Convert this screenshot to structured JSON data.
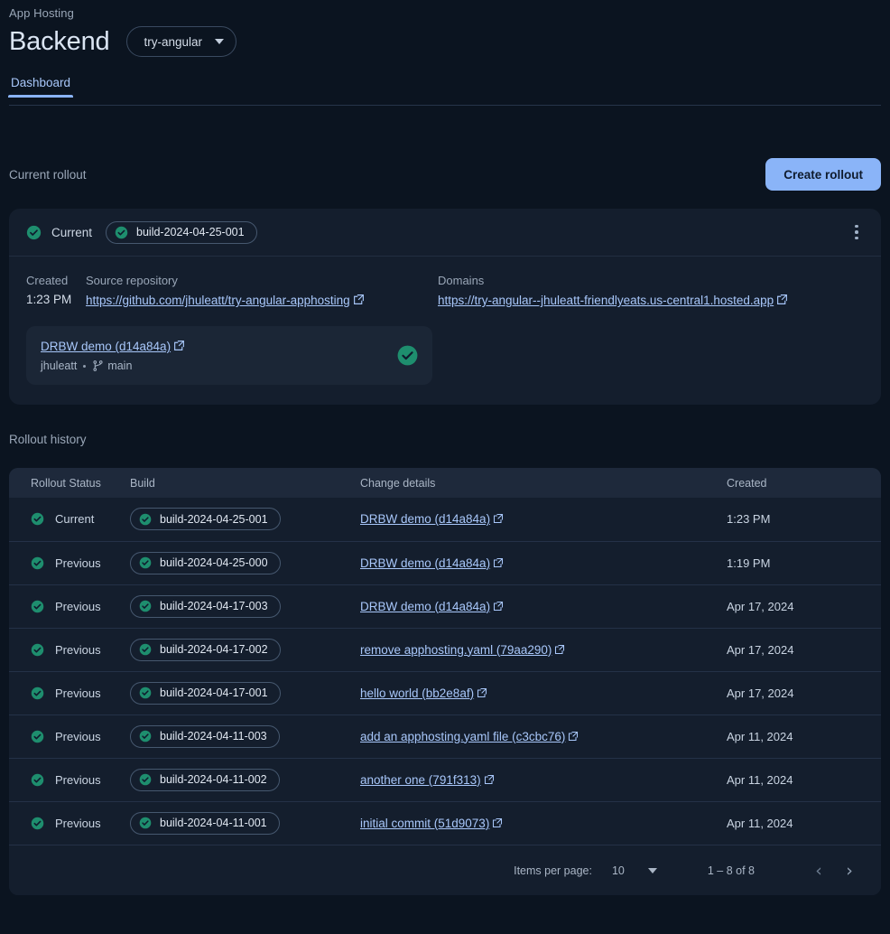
{
  "header": {
    "eyebrow": "App Hosting",
    "title": "Backend",
    "backend_chip": "try-angular",
    "chip_icon": "chevron-down-icon"
  },
  "tabs": [
    {
      "label": "Dashboard",
      "active": true
    }
  ],
  "current_rollout": {
    "section_title": "Current rollout",
    "create_button": "Create rollout",
    "status_label": "Current",
    "build_pill": "build-2024-04-25-001",
    "kebab_icon": "more-vertical-icon",
    "created_label": "Created",
    "created_value": "1:23 PM",
    "source_label": "Source repository",
    "source_url": "https://github.com/jhuleatt/try-angular-apphosting",
    "domains_label": "Domains",
    "domain_url": "https://try-angular--jhuleatt-friendlyeats.us-central1.hosted.app",
    "commit": {
      "title": "DRBW demo (d14a84a)",
      "author": "jhuleatt",
      "branch": "main",
      "branch_icon": "git-branch-icon",
      "status_icon": "check-circle-icon"
    }
  },
  "history": {
    "section_title": "Rollout history",
    "columns": [
      "Rollout Status",
      "Build",
      "Change details",
      "Created"
    ],
    "rows": [
      {
        "status": "Current",
        "build": "build-2024-04-25-001",
        "change": "DRBW demo (d14a84a)",
        "created": "1:23 PM"
      },
      {
        "status": "Previous",
        "build": "build-2024-04-25-000",
        "change": "DRBW demo (d14a84a)",
        "created": "1:19 PM"
      },
      {
        "status": "Previous",
        "build": "build-2024-04-17-003",
        "change": "DRBW demo (d14a84a)",
        "created": "Apr 17, 2024"
      },
      {
        "status": "Previous",
        "build": "build-2024-04-17-002",
        "change": "remove apphosting.yaml (79aa290)",
        "created": "Apr 17, 2024"
      },
      {
        "status": "Previous",
        "build": "build-2024-04-17-001",
        "change": "hello world (bb2e8af)",
        "created": "Apr 17, 2024"
      },
      {
        "status": "Previous",
        "build": "build-2024-04-11-003",
        "change": "add an apphosting.yaml file (c3cbc76)",
        "created": "Apr 11, 2024"
      },
      {
        "status": "Previous",
        "build": "build-2024-04-11-002",
        "change": "another one (791f313)",
        "created": "Apr 11, 2024"
      },
      {
        "status": "Previous",
        "build": "build-2024-04-11-001",
        "change": "initial commit (51d9073)",
        "created": "Apr 11, 2024"
      }
    ],
    "paginator": {
      "items_per_page_label": "Items per page:",
      "items_per_page_value": "10",
      "range": "1 – 8 of 8",
      "prev_icon": "chevron-left-icon",
      "next_icon": "chevron-right-icon"
    }
  },
  "colors": {
    "page_bg": "#0b1420",
    "card_bg": "#141e2d",
    "accent_blue": "#8ab4f8",
    "link_blue": "#a8c7fa",
    "success_green": "#1e8e6e"
  }
}
